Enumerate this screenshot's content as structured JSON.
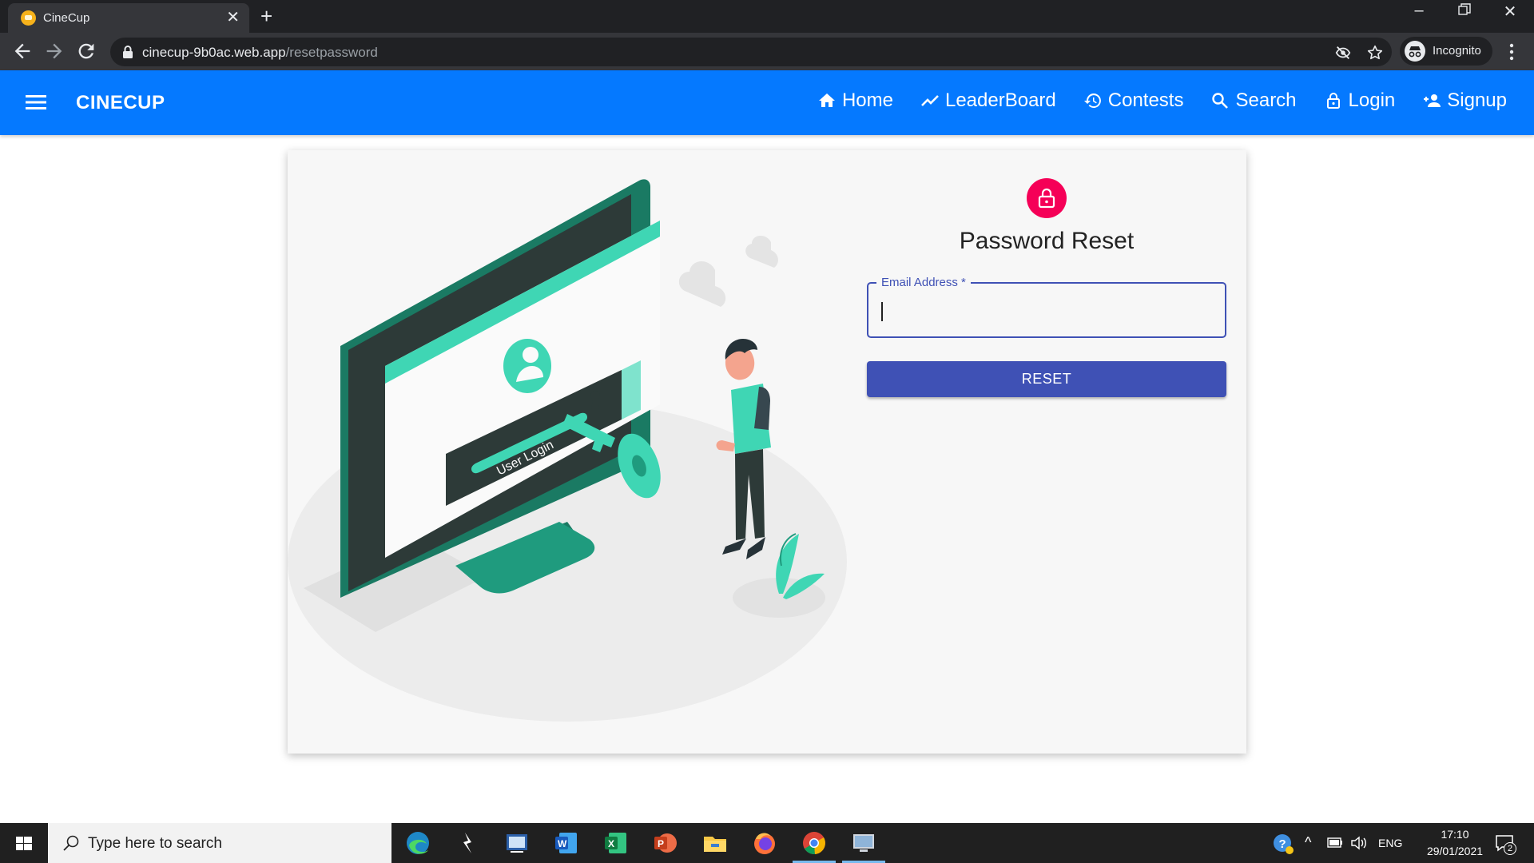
{
  "browser": {
    "tab_title": "CineCup",
    "url_host": "cinecup-9b0ac.web.app",
    "url_path": "/resetpassword",
    "profile_label": "Incognito"
  },
  "app": {
    "brand": "CINECUP",
    "nav": [
      {
        "label": "Home",
        "icon": "home-icon"
      },
      {
        "label": "LeaderBoard",
        "icon": "trending-up-icon"
      },
      {
        "label": "Contests",
        "icon": "history-icon"
      },
      {
        "label": "Search",
        "icon": "search-icon"
      },
      {
        "label": "Login",
        "icon": "lock-icon"
      },
      {
        "label": "Signup",
        "icon": "person-add-icon"
      }
    ],
    "colors": {
      "appbar": "#0579ff",
      "primary": "#3f51b5",
      "avatar": "#f50057",
      "illustration_accent": "#3fd6b4"
    }
  },
  "form": {
    "title": "Password Reset",
    "email_label": "Email Address *",
    "email_value": "",
    "submit_label": "RESET"
  },
  "illustration": {
    "caption": "User Login"
  },
  "taskbar": {
    "search_placeholder": "Type here to search",
    "language": "ENG",
    "time": "17:10",
    "date": "29/01/2021",
    "notification_count": "2",
    "apps": [
      "edge-icon",
      "app-icon",
      "screen-capture-icon",
      "word-icon",
      "excel-icon",
      "powerpoint-icon",
      "file-explorer-icon",
      "firefox-icon",
      "chrome-icon",
      "monitor-icon"
    ]
  }
}
